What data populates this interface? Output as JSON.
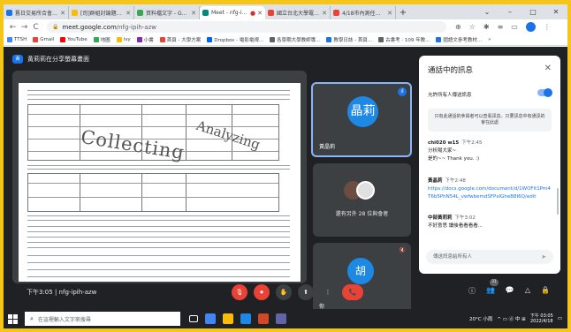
{
  "browser": {
    "tabs": [
      {
        "title": "舊日交易所合會所 - 臺",
        "color": "#1a73e8",
        "active": false
      },
      {
        "title": "[司]群組討論題運手",
        "color": "#fbbc04",
        "active": false
      },
      {
        "title": "資料檔文字 - Google",
        "color": "#34a853",
        "active": false
      },
      {
        "title": "Meet - nfg-ipih",
        "color": "#00897b",
        "active": true,
        "recording": "●"
      },
      {
        "title": "國立台北大學電子郵",
        "color": "#ea4335",
        "active": false
      },
      {
        "title": "4/18市內測任務一覽",
        "color": "#ea4335",
        "active": false
      }
    ],
    "new_tab": "+",
    "window_controls": [
      "⌄",
      "–",
      "□",
      "✕"
    ],
    "url_host": "meet.google.com",
    "url_path": "/nfg-ipih-azw",
    "nav": [
      "←",
      "→",
      "C",
      "⌂"
    ],
    "toolbar_icons": [
      "⊕",
      "☆",
      "✱",
      "≡",
      "▭"
    ],
    "profile_initial": "",
    "bookmarks": [
      {
        "label": "TTSH",
        "color": "#4285f4"
      },
      {
        "label": "Gmail",
        "color": "#ea4335"
      },
      {
        "label": "YouTube",
        "color": "#ff0000"
      },
      {
        "label": "地圖",
        "color": "#34a853"
      },
      {
        "label": "ivy",
        "color": "#fbbc04"
      },
      {
        "label": "小書",
        "color": "#8e24aa"
      },
      {
        "label": "首頁 - 大學方案",
        "color": "#ea4335"
      },
      {
        "label": "Dropbox - 電影電視...",
        "color": "#0061ff"
      },
      {
        "label": "各學期大學教師專...",
        "color": "#5f6368"
      },
      {
        "label": "教學日誌 - 首頁...",
        "color": "#1a73e8"
      },
      {
        "label": "古書考 · 109 年教...",
        "color": "#5f6368"
      },
      {
        "label": "國語文參考教材...",
        "color": "#1a73e8"
      }
    ],
    "bookmarks_more": "»"
  },
  "meet": {
    "presenter_badge": "黃",
    "presenter_title": "黃莉莉在分享螢幕畫面",
    "slide_words": [
      "Collecting",
      "Analyzing"
    ],
    "participants": [
      {
        "name": "黃晶莉",
        "avatar": "晶莉",
        "color": "#1e88e5"
      },
      {
        "name": "你",
        "avatar": "胡",
        "color": "#1e88e5"
      }
    ],
    "others_label": "還有另外 28 位與會者",
    "voice_indicator": "ıl",
    "mic_off_icon": "🔇",
    "meeting_time": "下午3:05",
    "meeting_code": "nfg-ipih-azw",
    "controls": [
      "🎙",
      "⏺",
      "✋",
      "⬆",
      "⋮",
      "📞"
    ],
    "right_controls": [
      "ⓘ",
      "👥",
      "💬",
      "△",
      "🔒"
    ],
    "participant_count": "31"
  },
  "chat": {
    "header": "通話中的訊息",
    "close": "✕",
    "allow_label": "允許所有人傳送訊息",
    "notice": "只有此通話的參與者可以查看訊息。只要訊息中有通訊的會在此處",
    "messages": [
      {
        "author": "chi020 w15",
        "time": "下午2:45",
        "lines": [
          "分析陽大家~",
          "是的~~ Thank you. :)"
        ]
      },
      {
        "author": "黃晶莉",
        "time": "下午2:48",
        "lines": [],
        "link": "https://docs.google.com/document/d/1WOFlt1Pm4T6b5PhN54L_vwfwbemdSFPxlGheB8I6Q/edit"
      },
      {
        "author": "中部黃莉莉",
        "time": "下午3:02",
        "lines": [
          "不好意思 讀後看看看看..."
        ]
      }
    ],
    "input_placeholder": "傳送訊息給所有人",
    "send_icon": "➤"
  },
  "taskbar": {
    "search_placeholder": "在這裡輸入文字來搜尋",
    "search_icon": "⌕",
    "apps": [
      {
        "name": "task-view",
        "color": "#ffffff"
      },
      {
        "name": "chrome",
        "color": "#4285f4"
      },
      {
        "name": "explorer",
        "color": "#fbbc04"
      },
      {
        "name": "edge",
        "color": "#1e88e5"
      },
      {
        "name": "powerpoint",
        "color": "#d24726"
      },
      {
        "name": "teams",
        "color": "#6264a7"
      }
    ],
    "weather": "20°C 小雨",
    "tray_icons": "^ ▭ ⓓ 中 ⊞",
    "clock_time": "下午 03:05",
    "clock_date": "2022/4/18",
    "notification_icon": "▭"
  }
}
